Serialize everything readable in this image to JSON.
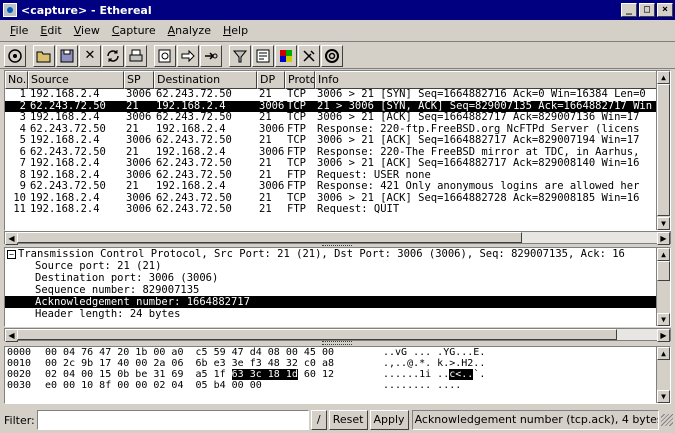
{
  "window": {
    "title": "<capture> - Ethereal"
  },
  "menu": [
    "File",
    "Edit",
    "View",
    "Capture",
    "Analyze",
    "Help"
  ],
  "toolbar": [
    "capture-icon",
    "open-icon",
    "save-icon",
    "close-icon",
    "reload-icon",
    "print-icon",
    "find-icon",
    "go-forward-icon",
    "go-to-packet-icon",
    "capture-filter-icon",
    "display-filter-icon",
    "coloring-icon",
    "preferences-icon",
    "help-icon"
  ],
  "packet_list": {
    "columns": [
      "No.",
      "Source",
      "SP",
      "Destination",
      "DP",
      "Protocol",
      "Info"
    ],
    "rows": [
      [
        "1",
        "192.168.2.4",
        "3006",
        "62.243.72.50",
        "21",
        "TCP",
        "3006 > 21 [SYN] Seq=1664882716 Ack=0 Win=16384 Len=0"
      ],
      [
        "2",
        "62.243.72.50",
        "21",
        "192.168.2.4",
        "3006",
        "TCP",
        "21 > 3006 [SYN, ACK] Seq=829007135 Ack=1664882717 Win"
      ],
      [
        "3",
        "192.168.2.4",
        "3006",
        "62.243.72.50",
        "21",
        "TCP",
        "3006 > 21 [ACK] Seq=1664882717 Ack=829007136 Win=17"
      ],
      [
        "4",
        "62.243.72.50",
        "21",
        "192.168.2.4",
        "3006",
        "FTP",
        "Response: 220-ftp.FreeBSD.org NcFTPd Server (licens"
      ],
      [
        "5",
        "192.168.2.4",
        "3006",
        "62.243.72.50",
        "21",
        "TCP",
        "3006 > 21 [ACK] Seq=1664882717 Ack=829007194 Win=17"
      ],
      [
        "6",
        "62.243.72.50",
        "21",
        "192.168.2.4",
        "3006",
        "FTP",
        "Response: 220-The FreeBSD mirror at TDC, in Aarhus,"
      ],
      [
        "7",
        "192.168.2.4",
        "3006",
        "62.243.72.50",
        "21",
        "TCP",
        "3006 > 21 [ACK] Seq=1664882717 Ack=829008140 Win=16"
      ],
      [
        "8",
        "192.168.2.4",
        "3006",
        "62.243.72.50",
        "21",
        "FTP",
        "Request: USER none"
      ],
      [
        "9",
        "62.243.72.50",
        "21",
        "192.168.2.4",
        "3006",
        "FTP",
        "Response: 421 Only anonymous logins are allowed her"
      ],
      [
        "10",
        "192.168.2.4",
        "3006",
        "62.243.72.50",
        "21",
        "TCP",
        "3006 > 21 [ACK] Seq=1664882728 Ack=829008185 Win=16"
      ],
      [
        "11",
        "192.168.2.4",
        "3006",
        "62.243.72.50",
        "21",
        "FTP",
        "Request: QUIT"
      ]
    ],
    "selected_row": 1
  },
  "detail": {
    "header": "Transmission Control Protocol, Src Port: 21 (21), Dst Port: 3006 (3006), Seq: 829007135, Ack: 16",
    "fields": [
      "Source port: 21 (21)",
      "Destination port: 3006 (3006)",
      "Sequence number: 829007135",
      "Acknowledgement number: 1664882717",
      "Header length: 24 bytes"
    ],
    "selected_field": 3
  },
  "hex": {
    "rows": [
      {
        "offset": "0000",
        "bytes": "00 04 76 47 20 1b 00 a0  c5 59 47 d4 08 00 45 00",
        "ascii": "..vG ... .YG...E."
      },
      {
        "offset": "0010",
        "bytes": "00 2c 9b 17 40 00 2a 06  6b e3 3e f3 48 32 c0 a8",
        "ascii": ".,..@.*. k.>.H2.."
      },
      {
        "offset": "0020",
        "bytes_pre": "02 04 00 15 0b be 31 69  a5 1f ",
        "bytes_hl": "63 3c 18 1d",
        "bytes_post": " 60 12",
        "ascii_pre": "......1i ..",
        "ascii_hl": "c<..",
        "ascii_post": "`."
      },
      {
        "offset": "0030",
        "bytes": "e0 00 10 8f 00 00 02 04  05 b4 00 00",
        "ascii": "........ ...."
      }
    ]
  },
  "status": {
    "filter_label": "Filter:",
    "filter_value": "",
    "slash_label": "/",
    "reset_label": "Reset",
    "apply_label": "Apply",
    "message": "Acknowledgement number (tcp.ack), 4 bytes"
  }
}
